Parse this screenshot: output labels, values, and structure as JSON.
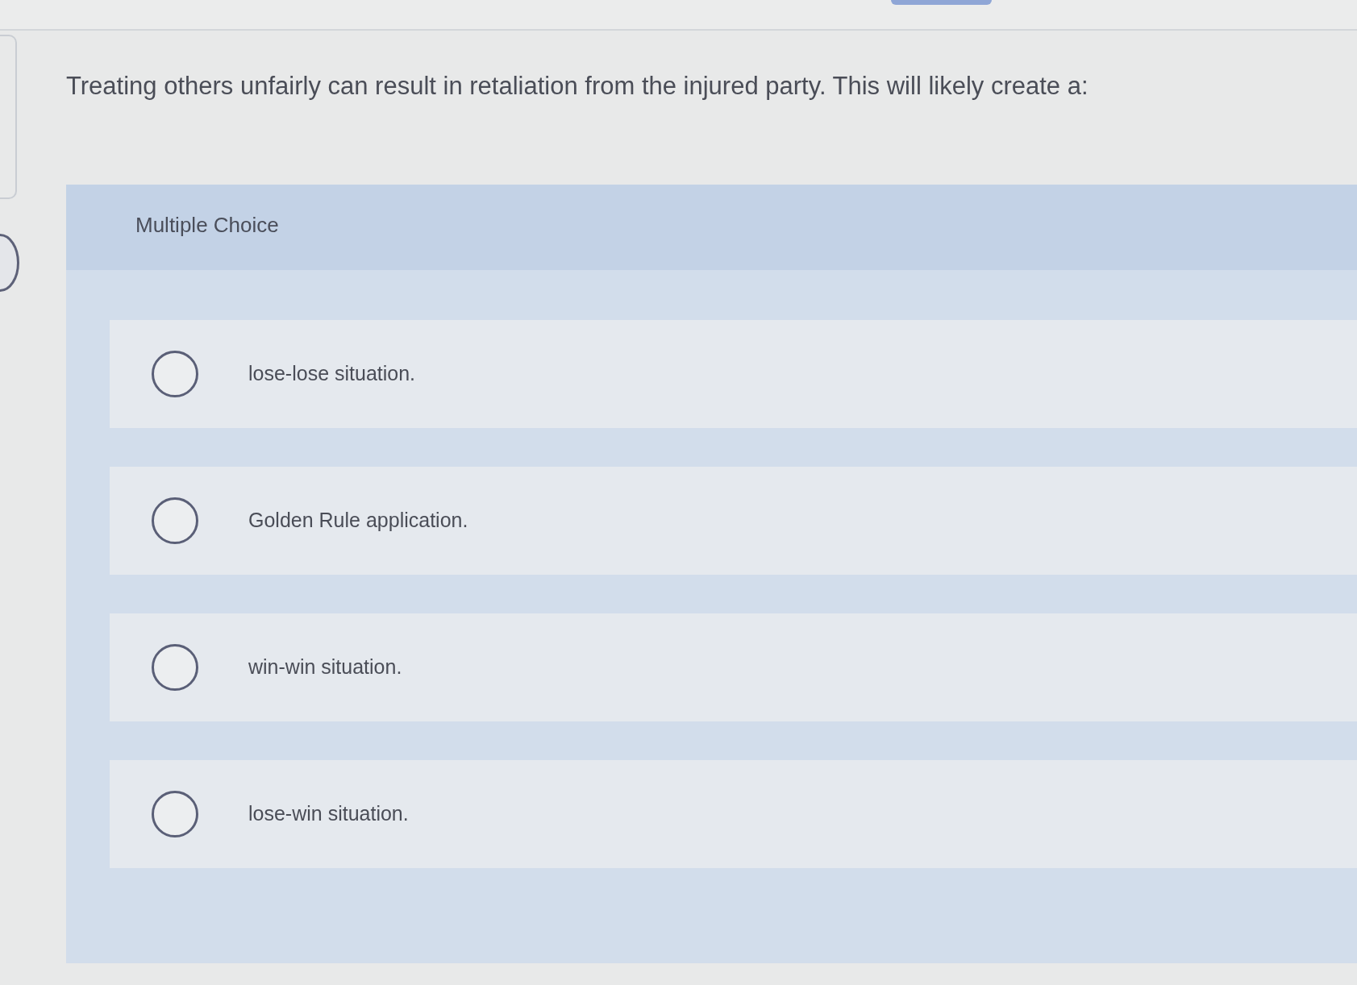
{
  "question": {
    "text": "Treating others unfairly can result in retaliation from the injured party. This will likely create a:"
  },
  "answer_panel": {
    "title": "Multiple Choice",
    "options": [
      {
        "label": "lose-lose situation.",
        "selected": false
      },
      {
        "label": "Golden Rule application.",
        "selected": false
      },
      {
        "label": "win-win situation.",
        "selected": false
      },
      {
        "label": "lose-win situation.",
        "selected": false
      }
    ]
  }
}
